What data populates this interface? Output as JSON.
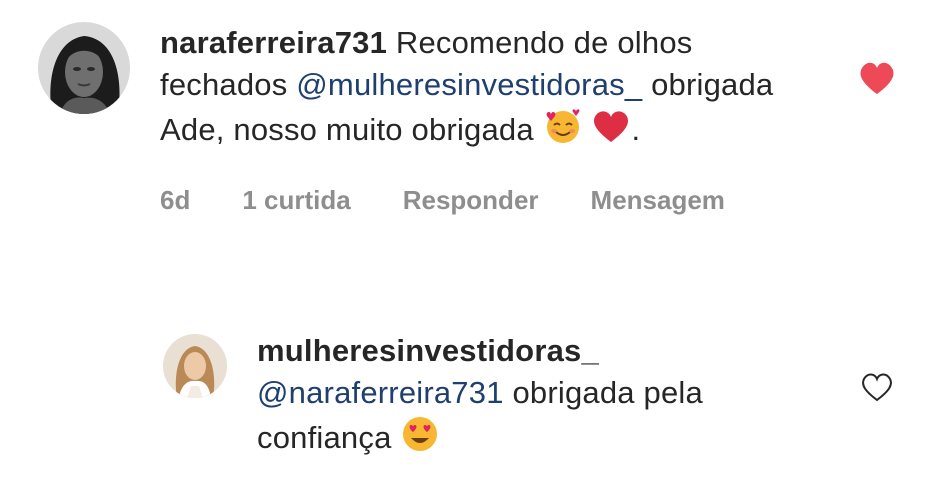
{
  "comment": {
    "username": "naraferreira731",
    "text_part1": "Recomendo de olhos fechados",
    "mention": "@mulheresinvestidoras_",
    "text_part2": "obrigada Ade, nosso muito obrigada",
    "text_end": ".",
    "emoji_1": "smiling-face-with-hearts",
    "emoji_2": "red-heart",
    "time": "6d",
    "likes": "1 curtida",
    "reply_label": "Responder",
    "message_label": "Mensagem",
    "liked": true,
    "like_color": "#ed4956"
  },
  "reply": {
    "username": "mulheresinvestidoras_",
    "mention": "@naraferreira731",
    "text": "obrigada pela confiança",
    "emoji": "heart-eyes",
    "liked": false
  },
  "colors": {
    "text": "#262626",
    "mention": "#1f3f6e",
    "meta": "#8e8e8e"
  }
}
